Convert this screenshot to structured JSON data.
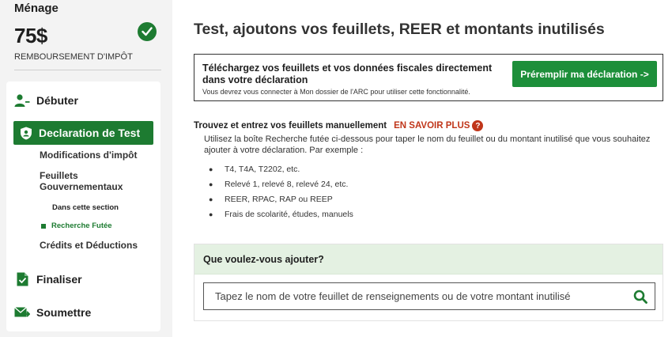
{
  "refund": {
    "household": "Ménage",
    "amount": "75$",
    "label": "REMBOURSEMENT D'IMPÔT"
  },
  "nav": {
    "start": "Débuter",
    "active": "Declaration de Test",
    "sub_modifications": "Modifications d'impôt",
    "sub_slips": "Feuillets Gouvernementaux",
    "in_section": "Dans cette section",
    "current": "Recherche Futée",
    "sub_credits": "Crédits et Déductions",
    "finalize": "Finaliser",
    "submit": "Soumettre"
  },
  "main": {
    "title": "Test, ajoutons vos feuillets, REER et montants inutilisés",
    "prefill": {
      "heading": "Téléchargez vos feuillets et vos données fiscales directement dans votre déclaration",
      "note": "Vous devrez vous connecter à Mon dossier de l'ARC pour utiliser cette fonctionnalité.",
      "button": "Préremplir ma déclaration ->"
    },
    "manual": {
      "heading": "Trouvez et entrez vos feuillets manuellement",
      "learn_more": "EN SAVOIR PLUS",
      "help_glyph": "?",
      "description": "Utilisez la boîte Recherche futée ci-dessous pour taper le nom du feuillet ou du montant inutilisé que vous souhaitez ajouter à votre déclaration. Par exemple :",
      "examples": [
        "T4, T4A, T2202, etc.",
        "Relevé 1, relevé 8, relevé 24, etc.",
        "REER, RPAC, RAP ou REEP",
        "Frais de scolarité, études, manuels"
      ]
    },
    "add": {
      "heading": "Que voulez-vous ajouter?",
      "placeholder": "Tapez le nom de votre feuillet de renseignements ou de votre montant inutilisé"
    }
  },
  "colors": {
    "brand_green": "#1d7b31",
    "button_green": "#1d8f3a",
    "accent_red": "#c0361a",
    "panel_header": "#e4f1e2"
  },
  "icons": {
    "refund_status": "check-circle-icon",
    "start": "person-add-icon",
    "active": "shield-icon",
    "finalize": "document-check-icon",
    "submit": "send-mail-icon",
    "help": "help-icon",
    "search": "search-icon"
  }
}
